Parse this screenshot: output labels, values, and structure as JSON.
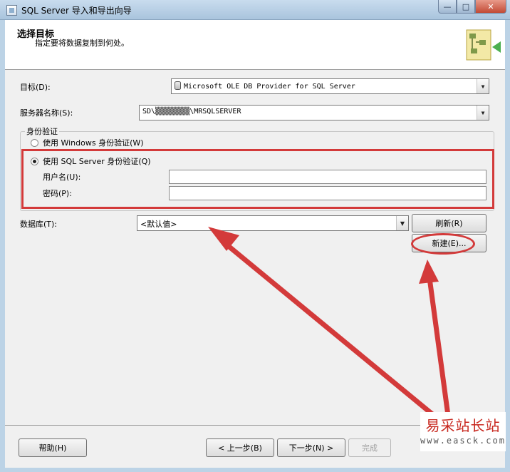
{
  "window": {
    "title": "SQL Server 导入和导出向导",
    "minimize_glyph": "—",
    "maximize_glyph": "□",
    "close_glyph": "✕"
  },
  "header": {
    "title": "选择目标",
    "subtitle": "指定要将数据复制到何处。",
    "icon": "wizard-destination-icon"
  },
  "form": {
    "destination_label": "目标(D):",
    "destination_value": "Microsoft OLE DB Provider for SQL Server",
    "server_label": "服务器名称(S):",
    "server_value": "SD\\▒▒▒▒▒▒▒▒\\MRSQLSERVER",
    "auth_group_label": "身份验证",
    "windows_auth_label": "使用 Windows 身份验证(W)",
    "sql_auth_label": "使用 SQL Server 身份验证(Q)",
    "selected_auth": "sql",
    "username_label": "用户名(U):",
    "username_value": "",
    "password_label": "密码(P):",
    "password_value": "",
    "database_label": "数据库(T):",
    "database_value": "<默认值>",
    "refresh_button": "刷新(R)",
    "new_button": "新建(E)..."
  },
  "footer": {
    "help_button": "帮助(H)",
    "back_button": "< 上一步(B)",
    "next_button": "下一步(N) >",
    "finish_button": "完成"
  },
  "annotation": {
    "color": "#d33a3a"
  },
  "watermark": {
    "text": "易采站长站",
    "url": "www.easck.com"
  }
}
